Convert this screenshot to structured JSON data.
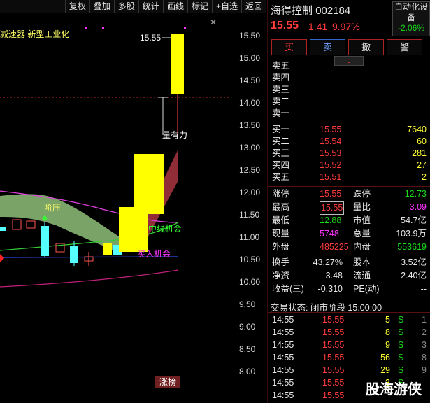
{
  "toolbar": {
    "items": [
      "复权",
      "叠加",
      "多股",
      "统计",
      "画线",
      "标记",
      "+自选",
      "返回"
    ]
  },
  "chart": {
    "y_labels": [
      "15.50",
      "15.00",
      "14.50",
      "14.00",
      "13.50",
      "13.00",
      "12.50",
      "12.00",
      "11.50",
      "11.00",
      "10.50",
      "10.00",
      "9.50",
      "9.00",
      "8.50",
      "8.00"
    ],
    "high_label": "15.55",
    "concept_text": "减速器 新型工业化",
    "annotations": {
      "volume": "量有力",
      "pressure": "阶压",
      "mid_chance": "中线机会",
      "buy_chance": "买入机会",
      "bottom_tag": "涨榜"
    },
    "colors": {
      "up": "#ffff00",
      "down": "#55ffff",
      "cloud_green": "#8fbf7a",
      "cloud_red": "#a0323c"
    }
  },
  "quote": {
    "name": "海得控制",
    "code": "002184",
    "price": "15.55",
    "change": "1.41",
    "pct": "9.97%",
    "auto_label_1": "自动化设",
    "auto_label_2": "备",
    "auto_pct": "-2.06%"
  },
  "buttons": [
    "买",
    "卖",
    "撤",
    "警"
  ],
  "sell_levels": [
    "卖五",
    "卖四",
    "卖三",
    "卖二",
    "卖一"
  ],
  "buy_levels": [
    {
      "label": "买一",
      "price": "15.55",
      "vol": "7640"
    },
    {
      "label": "买二",
      "price": "15.54",
      "vol": "60"
    },
    {
      "label": "买三",
      "price": "15.53",
      "vol": "281"
    },
    {
      "label": "买四",
      "price": "15.52",
      "vol": "27"
    },
    {
      "label": "买五",
      "price": "15.51",
      "vol": "2"
    }
  ],
  "stats": [
    {
      "l1": "涨停",
      "v1": "15.55",
      "c1": "red",
      "l2": "跌停",
      "v2": "12.73",
      "c2": "green"
    },
    {
      "l1": "最高",
      "v1": "15.55",
      "c1": "red",
      "l2": "量比",
      "v2": "3.09",
      "c2": "magenta"
    },
    {
      "l1": "最低",
      "v1": "12.88",
      "c1": "green",
      "l2": "市值",
      "v2": "54.7亿",
      "c2": "white"
    },
    {
      "l1": "现量",
      "v1": "5748",
      "c1": "magenta",
      "l2": "总量",
      "v2": "103.9万",
      "c2": "white"
    },
    {
      "l1": "外盘",
      "v1": "485225",
      "c1": "red",
      "l2": "内盘",
      "v2": "553619",
      "c2": "green"
    }
  ],
  "stats2": [
    {
      "l1": "换手",
      "v1": "43.27%",
      "l2": "股本",
      "v2": "3.52亿"
    },
    {
      "l1": "净资",
      "v1": "3.48",
      "l2": "流通",
      "v2": "2.40亿"
    },
    {
      "l1": "收益(三)",
      "v1": "-0.310",
      "l2": "PE(动)",
      "v2": "--"
    }
  ],
  "trade_status": "交易状态: 闭市阶段 15:00:00",
  "ticks": [
    {
      "t": "14:55",
      "p": "15.55",
      "v": "5",
      "s": "S",
      "n": "1"
    },
    {
      "t": "14:55",
      "p": "15.55",
      "v": "8",
      "s": "S",
      "n": "2"
    },
    {
      "t": "14:55",
      "p": "15.55",
      "v": "9",
      "s": "S",
      "n": "3"
    },
    {
      "t": "14:55",
      "p": "15.55",
      "v": "56",
      "s": "S",
      "n": "8"
    },
    {
      "t": "14:55",
      "p": "15.55",
      "v": "29",
      "s": "S",
      "n": "9"
    },
    {
      "t": "14:55",
      "p": "15.55",
      "v": "3",
      "s": "S",
      "n": ""
    },
    {
      "t": "14:55",
      "p": "15.55",
      "v": "",
      "s": "",
      "n": ""
    }
  ],
  "watermark": "股海游侠"
}
